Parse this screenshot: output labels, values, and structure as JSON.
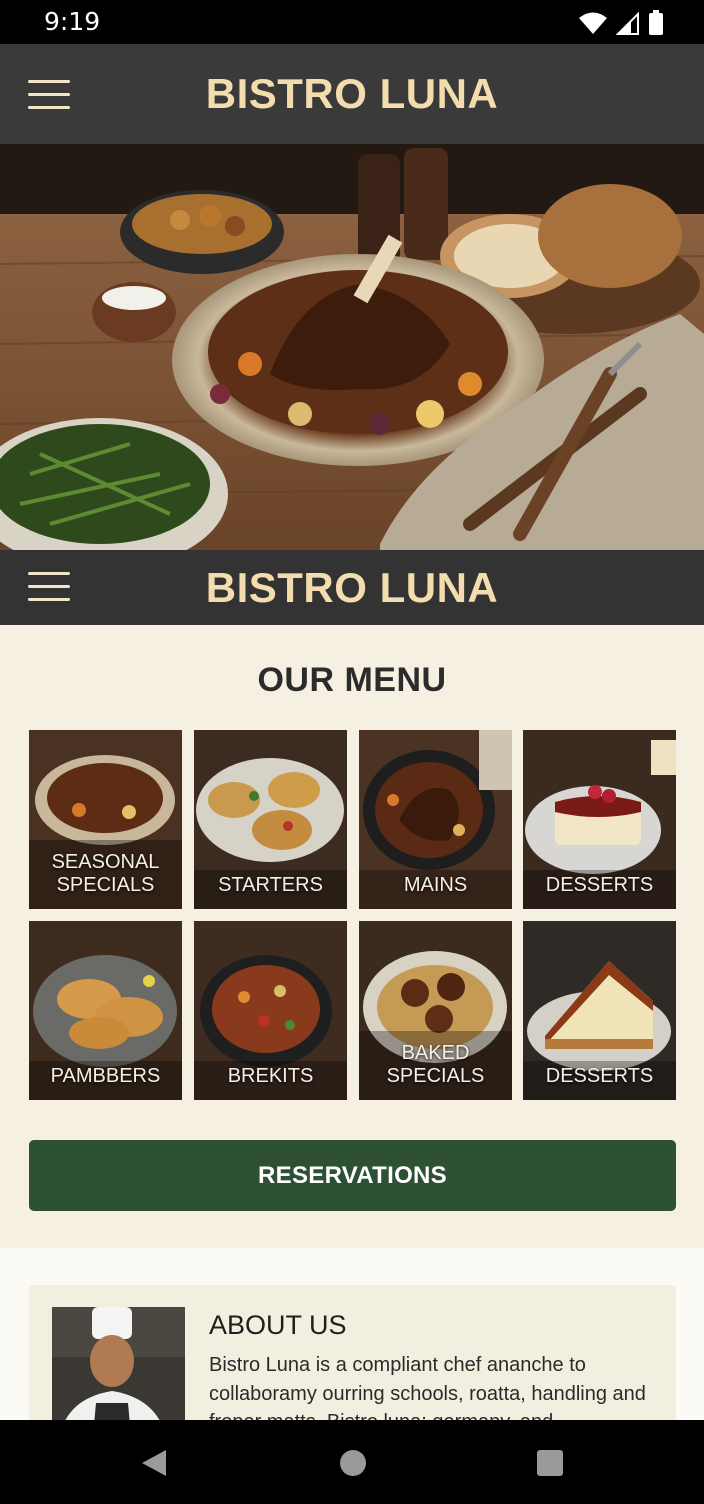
{
  "status_bar": {
    "time": "9:19"
  },
  "app": {
    "title": "BISTRO LUNA"
  },
  "menu": {
    "heading": "OUR MENU",
    "tiles": [
      {
        "label": "SEASONAL\nSPECIALS"
      },
      {
        "label": "STARTERS"
      },
      {
        "label": "MAINS"
      },
      {
        "label": "DESSERTS"
      },
      {
        "label": "PAMBBERS"
      },
      {
        "label": "BREKITS"
      },
      {
        "label": "BAKED\nSPECIALS"
      },
      {
        "label": "DESSERTS"
      }
    ]
  },
  "reservations": {
    "label": "RESERVATIONS"
  },
  "about": {
    "title": "ABOUT US",
    "text": "Bistro Luna is a compliant chef ananche to collaboramy ourring schools, roatta, handling and froper matts. Bistro luna: germany, and"
  },
  "colors": {
    "app_bar": "#3a3a3a",
    "title_gold": "#f3dcae",
    "cream": "#f5f0e1",
    "reservations_green": "#2e5033"
  }
}
